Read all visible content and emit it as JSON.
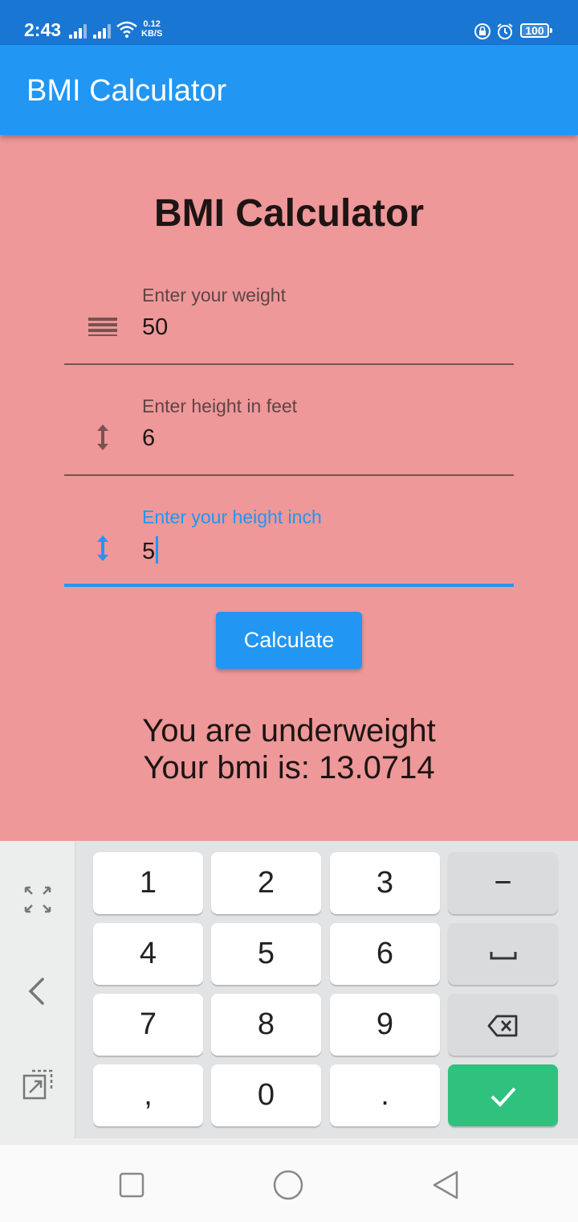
{
  "status_bar": {
    "time": "2:43",
    "net_speed_value": "0.12",
    "net_speed_unit": "KB/S",
    "battery": "100"
  },
  "app_bar": {
    "title": "BMI Calculator"
  },
  "main": {
    "heading": "BMI Calculator",
    "fields": [
      {
        "label": "Enter your weight",
        "value": "50",
        "icon": "weight-lines-icon"
      },
      {
        "label": "Enter height in feet",
        "value": "6",
        "icon": "vertical-arrows-icon"
      },
      {
        "label": "Enter your height inch",
        "value": "5",
        "icon": "vertical-arrows-icon",
        "focused": true
      }
    ],
    "calculate_label": "Calculate",
    "result_line1": "You are underweight",
    "result_line2": "Your bmi is: 13.0714"
  },
  "keyboard": {
    "keys": [
      "1",
      "2",
      "3",
      "−",
      "4",
      "5",
      "6",
      "space",
      "7",
      "8",
      "9",
      "backspace",
      ",",
      "0",
      ".",
      "enter"
    ],
    "labels": {
      "k1": "1",
      "k2": "2",
      "k3": "3",
      "minus": "−",
      "k4": "4",
      "k5": "5",
      "k6": "6",
      "k7": "7",
      "k8": "8",
      "k9": "9",
      "comma": ",",
      "k0": "0",
      "dot": "."
    },
    "side_icons": [
      "fullscreen-icon",
      "chevron-left-icon",
      "float-keyboard-icon"
    ]
  },
  "colors": {
    "primary": "#2196f3",
    "status_bar": "#1976d2",
    "content_bg": "#ee9899",
    "enter_key": "#2ec27e"
  }
}
